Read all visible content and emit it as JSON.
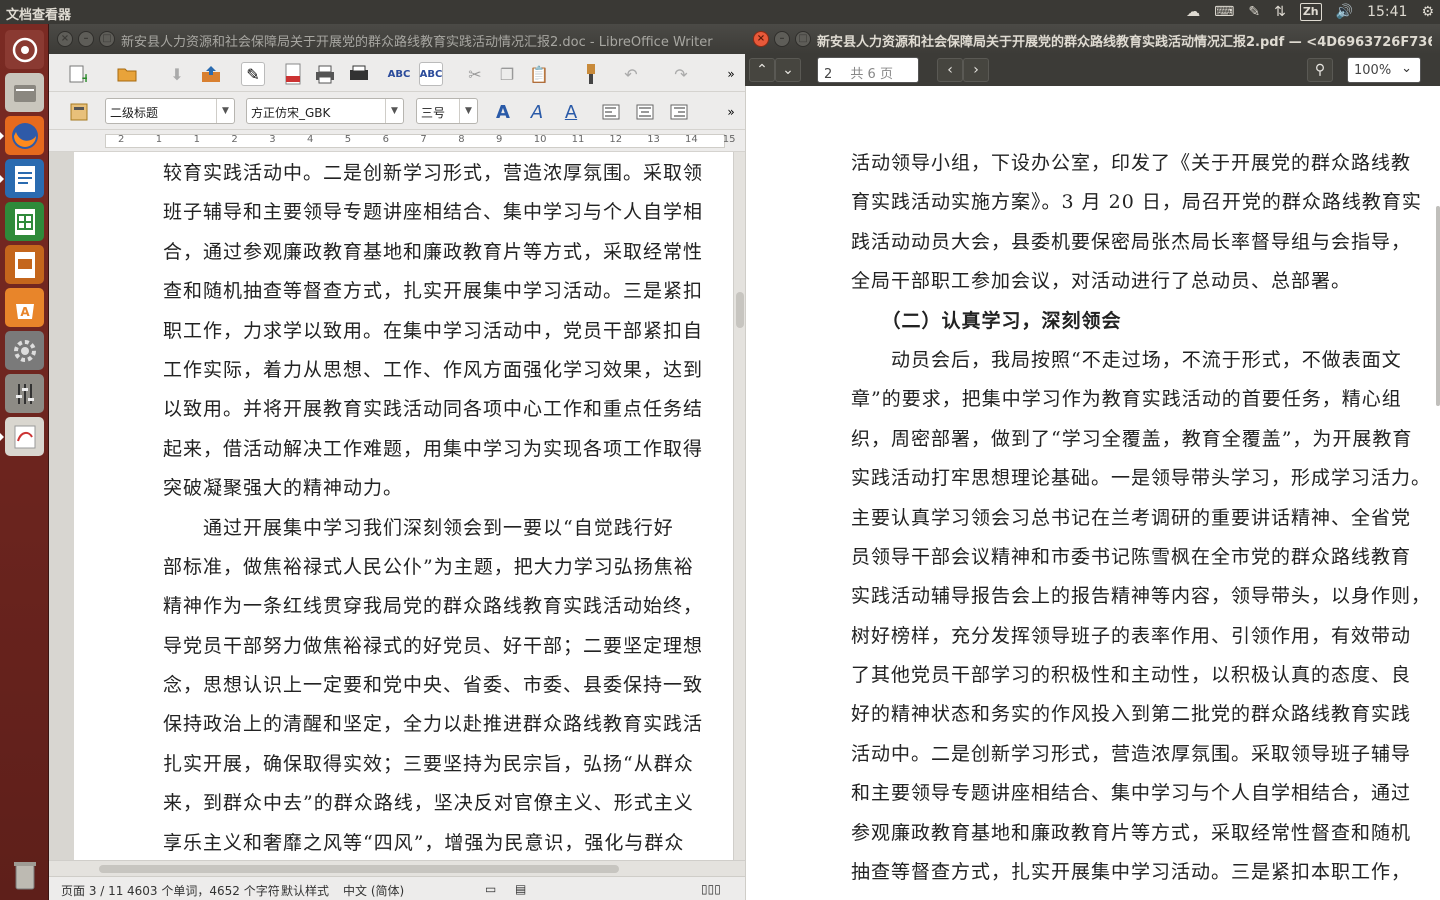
{
  "top_panel": {
    "app_title": "文档查看器",
    "ime": "Zh",
    "clock": "15:41"
  },
  "launcher": {
    "items": [
      "dash-icon",
      "files-icon",
      "firefox-icon",
      "writer-icon",
      "calc-icon",
      "impress-icon",
      "software-center-icon",
      "system-settings-icon",
      "mixer-icon",
      "document-viewer-icon",
      "trash-icon"
    ]
  },
  "writer": {
    "title": "新安县人力资源和社会保障局关于开展党的群众路线教育实践活动情况汇报2.doc - LibreOffice Writer",
    "paragraph_style": "二级标题",
    "font_name": "方正仿宋_GBK",
    "font_size": "三号",
    "ruler_numbers": [
      "2",
      "1",
      "1",
      "2",
      "3",
      "4",
      "5",
      "6",
      "7",
      "8",
      "9",
      "10",
      "11",
      "12",
      "13",
      "14",
      "15"
    ],
    "lines": [
      "较育实践活动中。二是创新学习形式，营造浓厚氛围。采取领",
      "班子辅导和主要领导专题讲座相结合、集中学习与个人自学相",
      "合，通过参观廉政教育基地和廉政教育片等方式，采取经常性",
      "查和随机抽查等督查方式，扎实开展集中学习活动。三是紧扣",
      "职工作，力求学以致用。在集中学习活动中，党员干部紧扣自",
      "工作实际，着力从思想、工作、作风方面强化学习效果，达到",
      "以致用。并将开展教育实践活动同各项中心工作和重点任务结",
      "起来，借活动解决工作难题，用集中学习为实现各项工作取得",
      "突破凝聚强大的精神动力。",
      "　　通过开展集中学习我们深刻领会到一要以“自觉践行好",
      "部标准，做焦裕禄式人民公仆”为主题，把大力学习弘扬焦裕",
      "精神作为一条红线贯穿我局党的群众路线教育实践活动始终，",
      "导党员干部努力做焦裕禄式的好党员、好干部；二要坚定理想",
      "念，思想认识上一定要和党中央、省委、市委、县委保持一致",
      "保持政治上的清醒和坚定，全力以赴推进群众路线教育实践活",
      "扎实开展，确保取得实效；三要坚持为民宗旨，弘扬“从群众",
      "来，到群众中去”的群众路线，坚决反对官僚主义、形式主义",
      "享乐主义和奢靡之风等“四风”，增强为民意识，强化与群众",
      "血肉联系，真心真意为群众办实事、办好事，要保持清正廉"
    ],
    "status": {
      "page": "页面 3 / 11",
      "count": "4603 个单词，4652 个字符",
      "style": "默认样式",
      "language": "中文 (简体)"
    }
  },
  "pdf": {
    "title": "新安县人力资源和社会保障局关于开展党的群众路线教育实践活动情况汇报2.pdf — <4D6963726F736F66",
    "page_number": "2",
    "page_total": "共 6 页",
    "zoom": "100%",
    "lines": [
      {
        "text": "活动领导小组，下设办公室，印发了《关于开展党的群众路线教",
        "heading": false
      },
      {
        "text": "育实践活动实施方案》。3 月 20 日，局召开党的群众路线教育实",
        "heading": false
      },
      {
        "text": "践活动动员大会，县委机要保密局张杰局长率督导组与会指导，",
        "heading": false
      },
      {
        "text": "全局干部职工参加会议，对活动进行了总动员、总部署。",
        "heading": false
      },
      {
        "text": "　　（二）认真学习，深刻领会",
        "heading": true
      },
      {
        "text": "　　动员会后，我局按照“不走过场，不流于形式，不做表面文",
        "heading": false
      },
      {
        "text": "章”的要求，把集中学习作为教育实践活动的首要任务，精心组",
        "heading": false
      },
      {
        "text": "织，周密部署，做到了“学习全覆盖，教育全覆盖”，为开展教育",
        "heading": false
      },
      {
        "text": "实践活动打牢思想理论基础。一是领导带头学习，形成学习活力。",
        "heading": false
      },
      {
        "text": "主要认真学习领会习总书记在兰考调研的重要讲话精神、全省党",
        "heading": false
      },
      {
        "text": "员领导干部会议精神和市委书记陈雪枫在全市党的群众路线教育",
        "heading": false
      },
      {
        "text": "实践活动辅导报告会上的报告精神等内容，领导带头，以身作则，",
        "heading": false
      },
      {
        "text": "树好榜样，充分发挥领导班子的表率作用、引领作用，有效带动",
        "heading": false
      },
      {
        "text": "了其他党员干部学习的积极性和主动性，以积极认真的态度、良",
        "heading": false
      },
      {
        "text": "好的精神状态和务实的作风投入到第二批党的群众路线教育实践",
        "heading": false
      },
      {
        "text": "活动中。二是创新学习形式，营造浓厚氛围。采取领导班子辅导",
        "heading": false
      },
      {
        "text": "和主要领导专题讲座相结合、集中学习与个人自学相结合，通过",
        "heading": false
      },
      {
        "text": "参观廉政教育基地和廉政教育片等方式，采取经常性督查和随机",
        "heading": false
      },
      {
        "text": "抽查等督查方式，扎实开展集中学习活动。三是紧扣本职工作，",
        "heading": false
      }
    ]
  },
  "colors": {
    "launcher": "#6e2520",
    "panel": "#3a3935",
    "close_button": "#e8593a"
  }
}
